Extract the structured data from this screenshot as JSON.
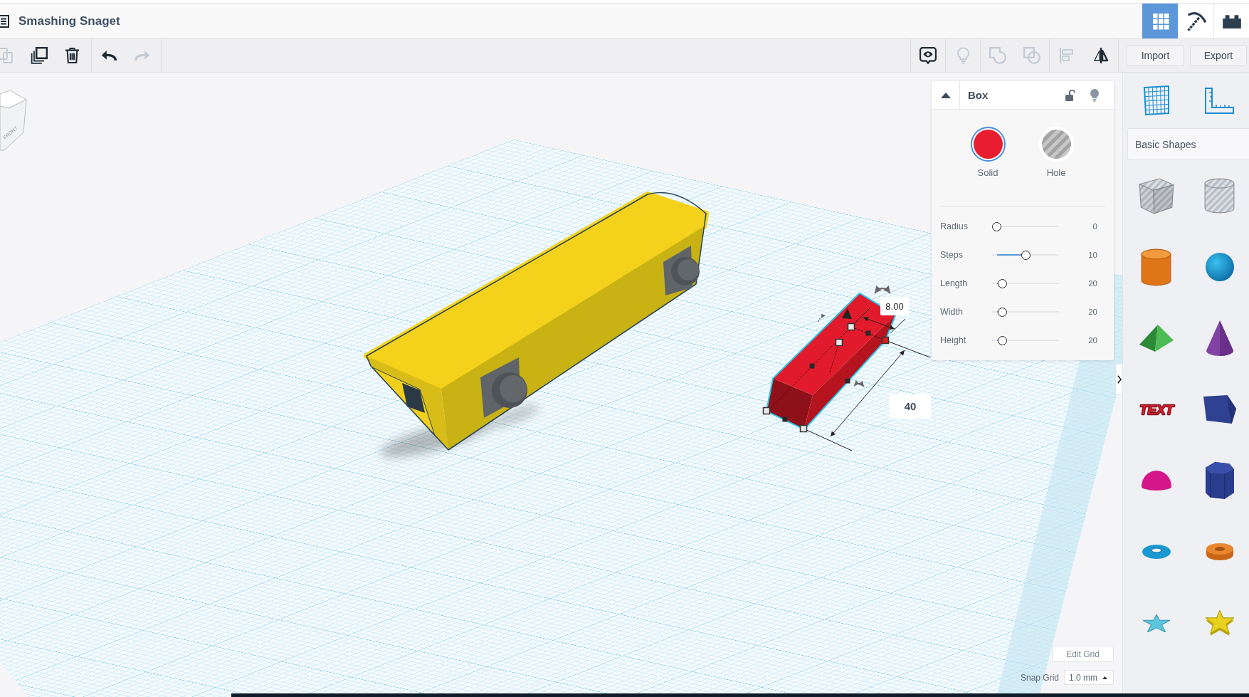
{
  "title_bar": {
    "title": "Smashing Snaget",
    "mode_buttons": [
      {
        "kind": "grid",
        "selected": true
      },
      {
        "kind": "pickaxe",
        "selected": false
      },
      {
        "kind": "bricks",
        "selected": false
      }
    ]
  },
  "toolbar": {
    "edit_groups": [
      [
        {
          "kind": "paste",
          "disabled": true
        },
        {
          "kind": "duplicate",
          "disabled": false
        },
        {
          "kind": "delete",
          "disabled": false
        }
      ],
      [
        {
          "kind": "undo",
          "disabled": false
        },
        {
          "kind": "redo",
          "disabled": true
        }
      ]
    ],
    "shape_groups": [
      [
        {
          "kind": "notes",
          "disabled": false
        }
      ],
      [
        {
          "kind": "show-all",
          "disabled": true
        }
      ],
      [
        {
          "kind": "group",
          "disabled": true
        },
        {
          "kind": "ungroup",
          "disabled": true
        }
      ],
      [
        {
          "kind": "align",
          "disabled": true
        },
        {
          "kind": "mirror",
          "disabled": false
        }
      ]
    ],
    "buttons": [
      "Import",
      "Export"
    ]
  },
  "canvas": {
    "view_cube": {
      "face_label": "FRONT"
    },
    "selection": {
      "height_label": "8.00",
      "length_label": "40"
    }
  },
  "inspector": {
    "title": "Box",
    "locked": false,
    "modes": [
      {
        "kind": "solid",
        "label": "Solid",
        "selected": true,
        "color": "#e81e30"
      },
      {
        "kind": "hole",
        "label": "Hole",
        "selected": false
      }
    ],
    "params": [
      {
        "label": "Radius",
        "level": 0,
        "value": "0"
      },
      {
        "label": "Steps",
        "level": 0.5,
        "value": "10"
      },
      {
        "label": "Length",
        "level": 0.1,
        "value": "20"
      },
      {
        "label": "Width",
        "level": 0.1,
        "value": "20"
      },
      {
        "label": "Height",
        "level": 0.1,
        "value": "20"
      }
    ]
  },
  "grid_controls": {
    "edit_button": "Edit Grid",
    "snap_label": "Snap Grid",
    "snap_value": "1.0 mm"
  },
  "shapes_panel": {
    "category": "Basic Shapes",
    "text_shape": "TEXT"
  }
}
